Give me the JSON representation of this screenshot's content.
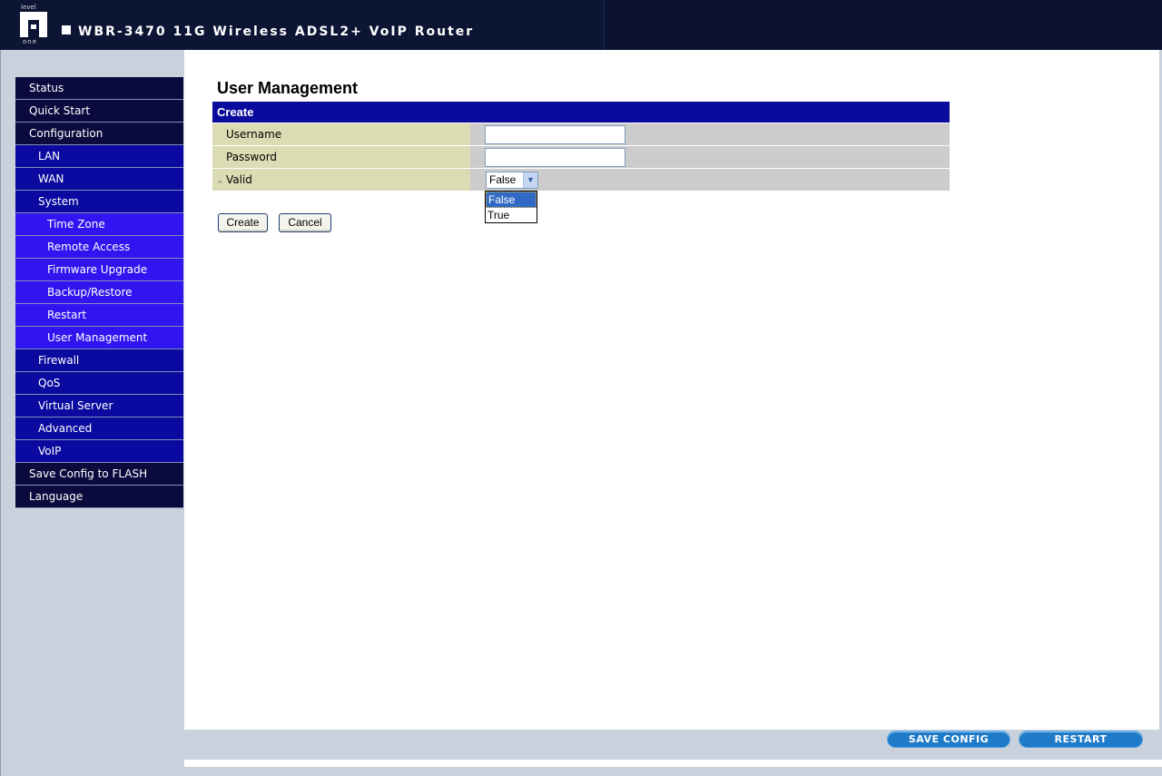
{
  "header": {
    "logo_top": "level",
    "logo_bottom": "one",
    "product_title": "WBR-3470 11G Wireless ADSL2+ VoIP Router"
  },
  "sidebar": {
    "items": [
      {
        "label": "Status",
        "level": 1
      },
      {
        "label": "Quick Start",
        "level": 1
      },
      {
        "label": "Configuration",
        "level": 1
      },
      {
        "label": "LAN",
        "level": 2
      },
      {
        "label": "WAN",
        "level": 2
      },
      {
        "label": "System",
        "level": 2
      },
      {
        "label": "Time Zone",
        "level": 3
      },
      {
        "label": "Remote Access",
        "level": 3
      },
      {
        "label": "Firmware Upgrade",
        "level": 3
      },
      {
        "label": "Backup/Restore",
        "level": 3
      },
      {
        "label": "Restart",
        "level": 3
      },
      {
        "label": "User Management",
        "level": 3
      },
      {
        "label": "Firewall",
        "level": 2
      },
      {
        "label": "QoS",
        "level": 2
      },
      {
        "label": "Virtual Server",
        "level": 2
      },
      {
        "label": "Advanced",
        "level": 2
      },
      {
        "label": "VoIP",
        "level": 2
      },
      {
        "label": "Save Config to FLASH",
        "level": 1
      },
      {
        "label": "Language",
        "level": 1
      }
    ]
  },
  "main": {
    "title": "User Management",
    "form": {
      "header": "Create",
      "username_label": "Username",
      "username_value": "",
      "password_label": "Password",
      "password_value": "",
      "valid_label": "Valid",
      "valid_selected": "False",
      "valid_options": [
        "False",
        "True"
      ],
      "valid_bullet": "^"
    },
    "buttons": {
      "create": "Create",
      "cancel": "Cancel"
    }
  },
  "footer": {
    "save_config": "SAVE CONFIG",
    "restart": "RESTART"
  },
  "colors": {
    "header_bg": "#0c1533",
    "nav_level1": "#0a0a3e",
    "nav_level2": "#0a0aa0",
    "nav_level3": "#3214f0",
    "form_header": "#0a0a9c",
    "label_cell": "#dcdcb4",
    "pill_button": "#1f7ac8"
  }
}
